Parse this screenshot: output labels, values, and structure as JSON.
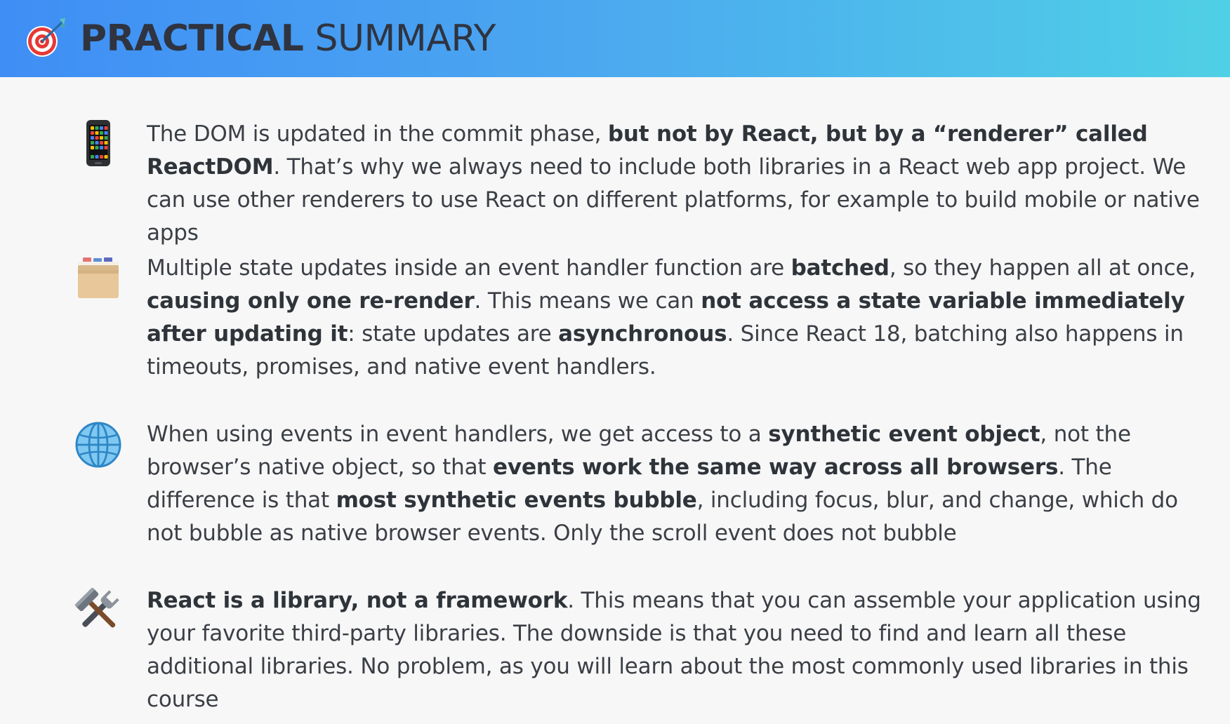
{
  "header": {
    "title_strong": "PRACTICAL",
    "title_rest": "SUMMARY",
    "icon": "target-dart-icon"
  },
  "items": [
    {
      "icon": "mobile-phone-icon",
      "parts": [
        {
          "text": "The DOM is updated in the commit phase, ",
          "bold": false
        },
        {
          "text": "but not by React, but by a “renderer” called ReactDOM",
          "bold": true
        },
        {
          "text": ". That’s why we always need to include both libraries in a React web app project. We can use other renderers to use React on different platforms, for example to build mobile or native apps",
          "bold": false
        }
      ]
    },
    {
      "icon": "card-file-box-icon",
      "parts": [
        {
          "text": "Multiple state updates inside an event handler function are ",
          "bold": false
        },
        {
          "text": "batched",
          "bold": true
        },
        {
          "text": ", so they happen all at once, ",
          "bold": false
        },
        {
          "text": "causing only one re-render",
          "bold": true
        },
        {
          "text": ". This means we can ",
          "bold": false
        },
        {
          "text": "not access a state variable immediately after updating it",
          "bold": true
        },
        {
          "text": ": state updates are ",
          "bold": false
        },
        {
          "text": "asynchronous",
          "bold": true
        },
        {
          "text": ". Since React 18, batching also happens in timeouts, promises, and native event handlers.",
          "bold": false
        }
      ]
    },
    {
      "icon": "globe-icon",
      "parts": [
        {
          "text": "When using events in event handlers, we get access to a ",
          "bold": false
        },
        {
          "text": "synthetic event object",
          "bold": true
        },
        {
          "text": ", not the browser’s native object, so that ",
          "bold": false
        },
        {
          "text": "events work the same way across all browsers",
          "bold": true
        },
        {
          "text": ". The difference is that ",
          "bold": false
        },
        {
          "text": "most synthetic events bubble",
          "bold": true
        },
        {
          "text": ", including focus, blur, and change, which do not bubble as native browser events. Only the scroll event does not bubble",
          "bold": false
        }
      ]
    },
    {
      "icon": "hammer-and-wrench-icon",
      "parts": [
        {
          "text": "React is a library, not a framework",
          "bold": true
        },
        {
          "text": ". This means that you can assemble your application using your favorite third-party libraries. The downside is that you need to find and learn all these additional libraries. No problem, as you will learn about the most commonly used libraries in this course",
          "bold": false
        }
      ]
    }
  ]
}
